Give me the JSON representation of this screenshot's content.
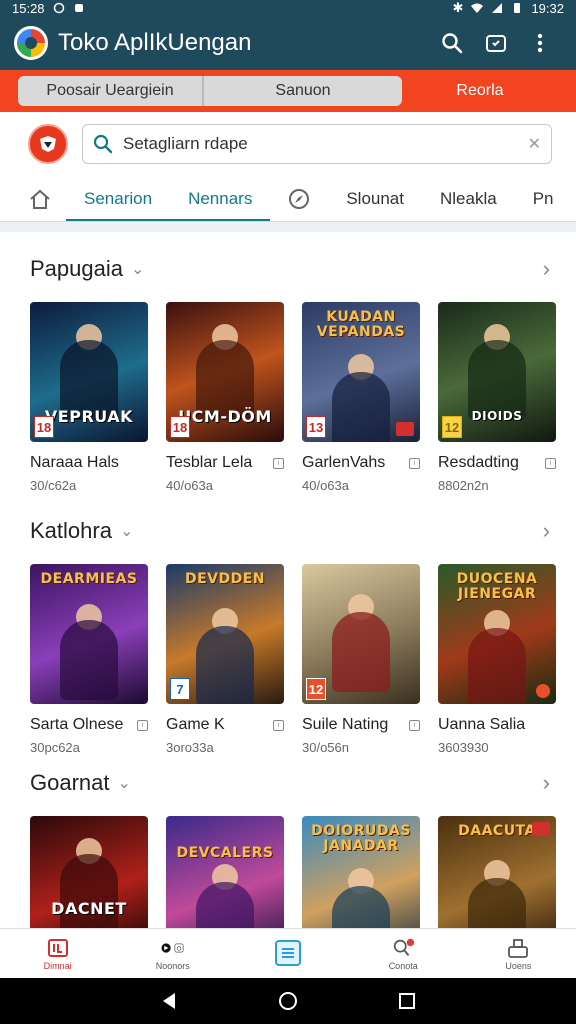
{
  "status": {
    "time_left": "15:28",
    "time_right": "19:32"
  },
  "app": {
    "title": "Toko AplIkUengan"
  },
  "tabstrip": {
    "tabs": [
      "Poosair Ueargiein",
      "Sanuon",
      "Reorla"
    ]
  },
  "search": {
    "value": "Setagliarn rdape"
  },
  "categories": [
    "Senarion",
    "Nennars",
    "Slounat",
    "Nleakla",
    "Pn"
  ],
  "sections": [
    {
      "title": "Papugaia",
      "items": [
        {
          "name": "Naraaa Hals",
          "meta": "30/c62a",
          "art_title": "VEPRUAK",
          "rating": "18"
        },
        {
          "name": "Tesblar Lela",
          "meta": "40/o63a",
          "art_title": "UCM-DÖM",
          "rating": "18"
        },
        {
          "name": "GarlenVahs",
          "meta": "40/o63a",
          "art_title": "KUADAN VEPANDAS",
          "rating": "13"
        },
        {
          "name": "Resdadting",
          "meta": "8802n2n",
          "art_title": "DIOIDS",
          "rating": "12"
        }
      ]
    },
    {
      "title": "Katlohra",
      "items": [
        {
          "name": "Sarta Olnese",
          "meta": "30pc62a",
          "art_title": "DEARMIEAS",
          "rating": ""
        },
        {
          "name": "Game K",
          "meta": "3oro33a",
          "art_title": "DEVDDEN",
          "rating": "7"
        },
        {
          "name": "Suile Nating",
          "meta": "30/o56n",
          "art_title": "",
          "rating": "12"
        },
        {
          "name": "Uanna Salia",
          "meta": "3603930",
          "art_title": "DUOCENA JIENEGAR",
          "rating": ""
        }
      ]
    },
    {
      "title": "Goarnat",
      "items": [
        {
          "name": "",
          "meta": "",
          "art_title": "DACNET",
          "rating": ""
        },
        {
          "name": "",
          "meta": "",
          "art_title": "DEVCALERS",
          "rating": ""
        },
        {
          "name": "",
          "meta": "",
          "art_title": "DOIORUDAS JANADAR",
          "rating": ""
        },
        {
          "name": "",
          "meta": "",
          "art_title": "DAACUTA",
          "rating": ""
        }
      ]
    }
  ],
  "bottomnav": [
    "Dimnai",
    "Noonors",
    "",
    "Conota",
    "Uoens"
  ],
  "colors": {
    "appbar": "#1f4a5c",
    "accent": "#f2441f",
    "active_tab": "#137a8a"
  }
}
